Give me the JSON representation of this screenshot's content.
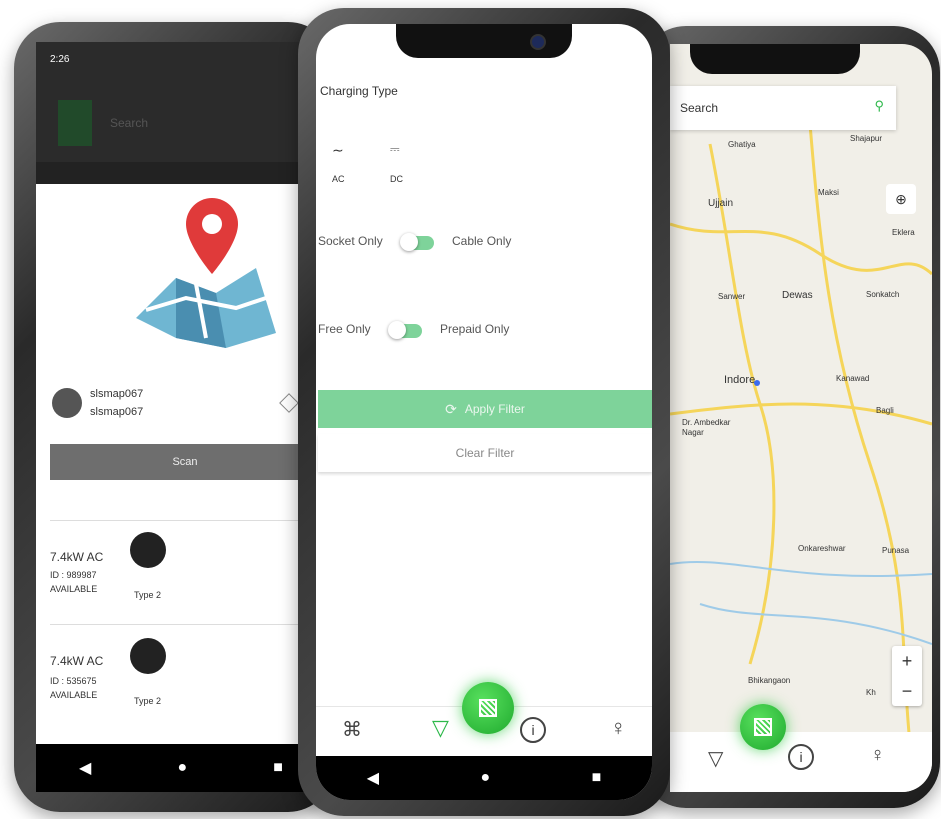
{
  "left_phone": {
    "status_time": "2:26",
    "search_placeholder": "Search",
    "station_name_1": "slsmap067",
    "station_name_2": "slsmap067",
    "scan_label": "Scan",
    "connectors": [
      {
        "power": "7.4kW AC",
        "id": "ID : 989987",
        "status": "AVAILABLE",
        "type": "Type 2"
      },
      {
        "power": "7.4kW AC",
        "id": "ID : 535675",
        "status": "AVAILABLE",
        "type": "Type 2"
      }
    ]
  },
  "center_phone": {
    "charging_type_label": "Charging Type",
    "ac_label": "AC",
    "dc_label": "DC",
    "socket_only": "Socket Only",
    "cable_only": "Cable Only",
    "free_only": "Free Only",
    "prepaid_only": "Prepaid Only",
    "apply_filter": "Apply Filter",
    "clear_filter": "Clear Filter"
  },
  "right_phone": {
    "search_label": "Search",
    "map_labels": [
      "Ghatiya",
      "Shajapur",
      "Ujjain",
      "Maksi",
      "Eklera",
      "Sanwer",
      "Dewas",
      "Sonkatch",
      "Indore",
      "Kanawad",
      "Dr. Ambedkar Nagar",
      "Bagli",
      "Onkareshwar",
      "Punasa",
      "Bhikangaon",
      "Kh"
    ],
    "zoom_in": "+",
    "zoom_out": "−"
  },
  "colors": {
    "accent_green": "#2db84a",
    "light_green": "#7ed39a",
    "map_bg": "#f1efe8",
    "road_yellow": "#f5d55a"
  }
}
